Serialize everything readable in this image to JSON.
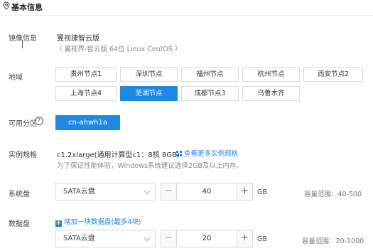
{
  "section": {
    "title": "基本信息"
  },
  "image": {
    "label": "镜像信息",
    "name": "翼视捷智云版",
    "detail": "（ 翼视界-智云版 64位 Linux CentOS ）"
  },
  "region": {
    "label": "地域",
    "options": [
      "贵州节点1",
      "深圳节点",
      "福州节点",
      "杭州节点",
      "西安节点2",
      "上海节点4",
      "芜湖节点",
      "成都节点3",
      "乌鲁木齐"
    ],
    "selected": "芜湖节点"
  },
  "zone": {
    "label": "可用分区",
    "help": "?",
    "selected": "cn-ahwh1a"
  },
  "spec": {
    "label": "实例规格",
    "value": "c1.2xlarge(通用计算型c1：8核 8GB)",
    "more_link": "查看更多实例规格",
    "note": "为了保证性能体验，Windows系统建议选择2GB及以上内存。"
  },
  "system_disk": {
    "label": "系统盘",
    "type": "SATA云盘",
    "minus": "−",
    "plus": "+",
    "size": "40",
    "unit": "GB",
    "range": "容量范围：40-500"
  },
  "data_disk": {
    "label": "数据盘",
    "add_link": "增加一块数据盘(最多4块)",
    "type": "SATA云盘",
    "minus": "−",
    "plus": "+",
    "size": "20",
    "unit": "GB",
    "range": "容量范围：20-1000"
  },
  "colors": {
    "accent": "#1e88e5"
  }
}
